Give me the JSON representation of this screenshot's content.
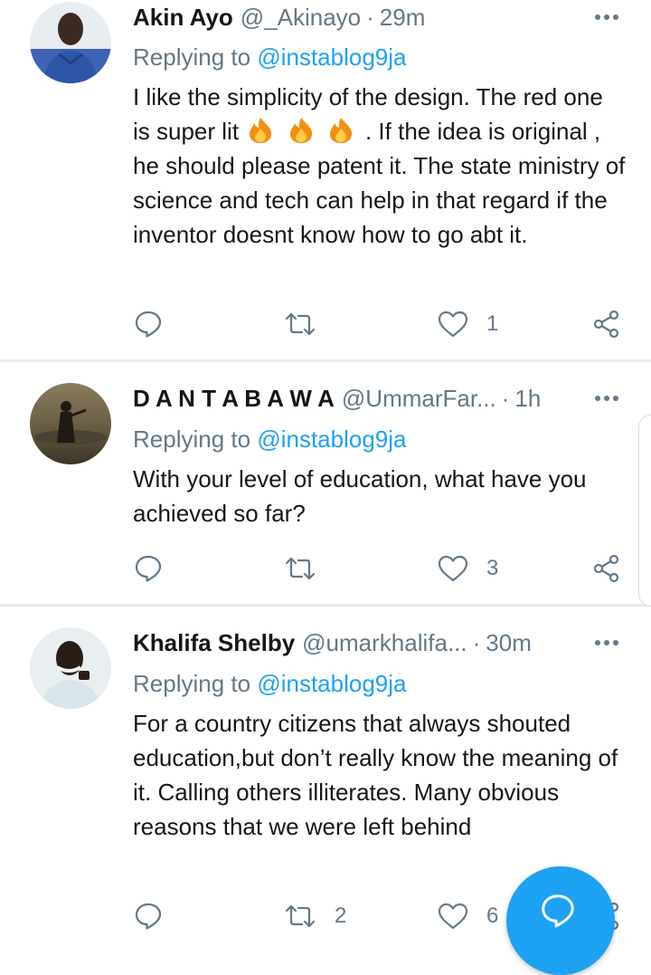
{
  "tweets": [
    {
      "name": "Akin Ayo",
      "handle": "@_Akinayo",
      "time": "29m",
      "replying_prefix": "Replying to",
      "replying_to": "@instablog9ja",
      "text_line1": "I like the simplicity of the design. The red one is super lit",
      "emoji": [
        "fire-emoji",
        "fire-emoji",
        "fire-emoji"
      ],
      "text_line2": ". If the idea is original , he should please patent it. The state ministry of science and tech can help in that regard if the inventor doesnt know how to go abt it.",
      "retweets": "",
      "likes": "1"
    },
    {
      "name": "D A N T A B A W A",
      "handle": "@UmmarFar...",
      "time": "1h",
      "replying_prefix": "Replying to",
      "replying_to": "@instablog9ja",
      "text": "With your level of education, what have you achieved so far?",
      "retweets": "",
      "likes": "3"
    },
    {
      "name": "Khalifa Shelby",
      "handle": "@umarkhalifa...",
      "time": "30m",
      "replying_prefix": "Replying to",
      "replying_to": "@instablog9ja",
      "text": "For a country citizens that always shouted education,but don’t really know the meaning of it. Calling others illiterates. Many obvious reasons that we were left behind",
      "retweets": "2",
      "likes": "6"
    }
  ],
  "separator": "·",
  "icons": {
    "reply": "reply-icon",
    "retweet": "retweet-icon",
    "like": "heart-icon",
    "share": "share-icon",
    "more": "more-dots-icon",
    "compose": "compose-reply-icon"
  },
  "colors": {
    "accent": "#1da1f2",
    "secondary_text": "#657786",
    "primary_text": "#14171a",
    "divider": "#e6ecf0"
  }
}
